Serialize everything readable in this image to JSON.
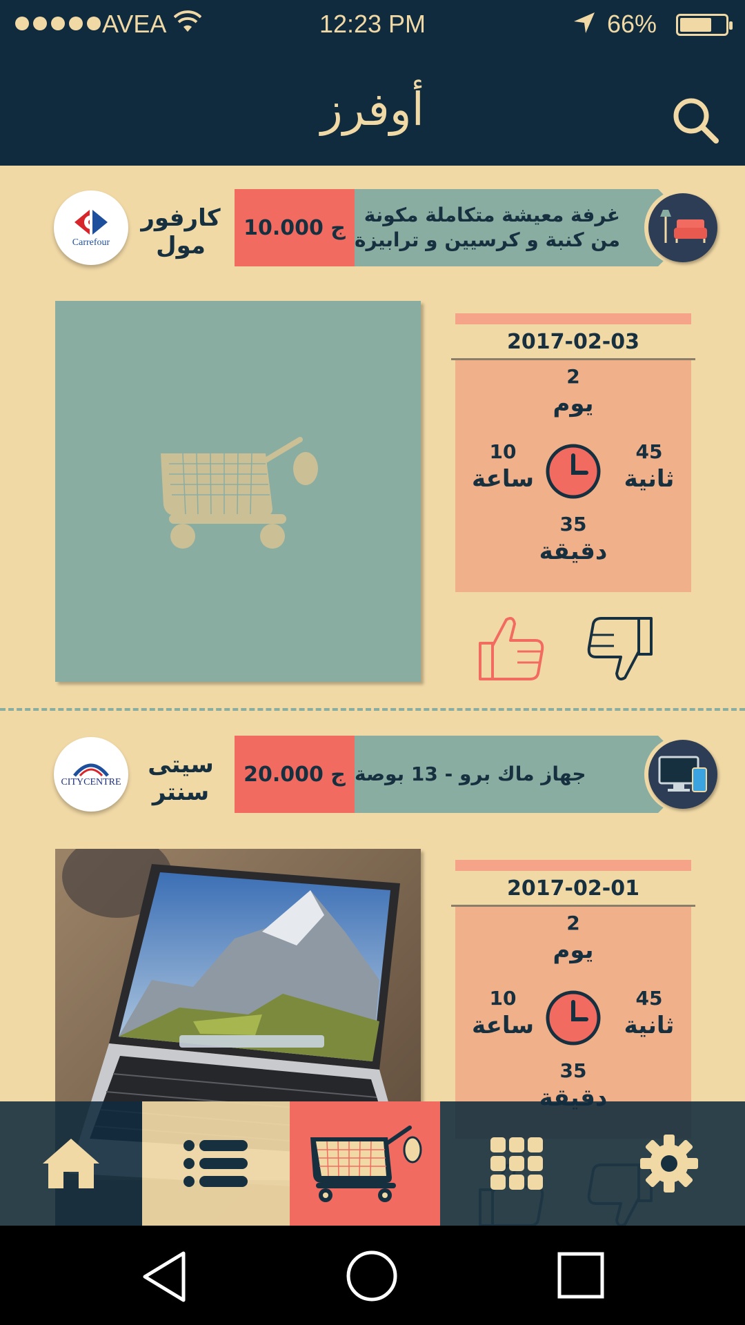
{
  "status_bar": {
    "carrier": "AVEA",
    "time": "12:23 PM",
    "battery": "66%"
  },
  "header": {
    "title": "أوفرز",
    "search_icon": "search-icon"
  },
  "offers": [
    {
      "store": {
        "name_line1": "كارفور",
        "name_line2": "مول",
        "logo_text": "Carrefour"
      },
      "price": "10.000 ج",
      "title_line1": "غرفة معيشة متكاملة مكونة",
      "title_line2": "من كنبة و كرسيين و ترابيزة",
      "category_icon": "sofa-icon",
      "date": "2017-02-03",
      "countdown": {
        "days": "2",
        "days_label": "يوم",
        "hours": "10",
        "hours_label": "ساعة",
        "seconds": "45",
        "seconds_label": "ثانية",
        "minutes": "35",
        "minutes_label": "دقيقة"
      }
    },
    {
      "store": {
        "name_line1": "سيتى",
        "name_line2": "سنتر",
        "logo_text": "CITYCENTRE"
      },
      "price": "20.000 ج",
      "title_line1": "جهاز ماك برو - 13 بوصة",
      "title_line2": "",
      "category_icon": "computer-icon",
      "date": "2017-02-01",
      "countdown": {
        "days": "2",
        "days_label": "يوم",
        "hours": "10",
        "hours_label": "ساعة",
        "seconds": "45",
        "seconds_label": "ثانية",
        "minutes": "35",
        "minutes_label": "دقيقة"
      }
    }
  ],
  "bottom_nav": [
    "home-icon",
    "list-icon",
    "cart-icon",
    "grid-icon",
    "gear-icon"
  ],
  "colors": {
    "navy": "#102b3d",
    "cream": "#f1d9a6",
    "coral": "#f26b60",
    "sage": "#8aada2",
    "peach": "#f0b08a"
  }
}
